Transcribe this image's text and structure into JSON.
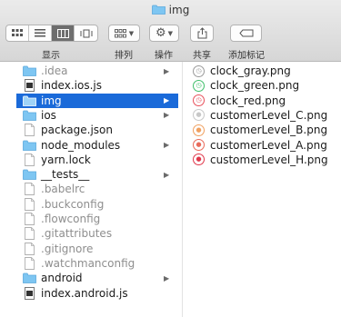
{
  "window": {
    "title": "img"
  },
  "toolbar": {
    "view_label": "显示",
    "arrange_label": "排列",
    "action_label": "操作",
    "share_label": "共享",
    "tag_label": "添加标记"
  },
  "column1": {
    "items": [
      {
        "name": ".idea",
        "kind": "folder",
        "dim": true,
        "arrow": true
      },
      {
        "name": "index.ios.js",
        "kind": "file",
        "dim": false,
        "arrow": false
      },
      {
        "name": "img",
        "kind": "folder",
        "dim": false,
        "arrow": true,
        "selected": true
      },
      {
        "name": "ios",
        "kind": "folder",
        "dim": false,
        "arrow": true
      },
      {
        "name": "package.json",
        "kind": "doc",
        "dim": false,
        "arrow": false
      },
      {
        "name": "node_modules",
        "kind": "folder",
        "dim": false,
        "arrow": true
      },
      {
        "name": "yarn.lock",
        "kind": "doc",
        "dim": false,
        "arrow": false
      },
      {
        "name": "__tests__",
        "kind": "folder",
        "dim": false,
        "arrow": true
      },
      {
        "name": ".babelrc",
        "kind": "doc",
        "dim": true,
        "arrow": false
      },
      {
        "name": ".buckconfig",
        "kind": "doc",
        "dim": true,
        "arrow": false
      },
      {
        "name": ".flowconfig",
        "kind": "doc",
        "dim": true,
        "arrow": false
      },
      {
        "name": ".gitattributes",
        "kind": "doc",
        "dim": true,
        "arrow": false
      },
      {
        "name": ".gitignore",
        "kind": "doc",
        "dim": true,
        "arrow": false
      },
      {
        "name": ".watchmanconfig",
        "kind": "doc",
        "dim": true,
        "arrow": false
      },
      {
        "name": "android",
        "kind": "folder",
        "dim": false,
        "arrow": true
      },
      {
        "name": "index.android.js",
        "kind": "file",
        "dim": false,
        "arrow": false
      }
    ]
  },
  "column2": {
    "items": [
      {
        "name": "clock_gray.png",
        "color": "#9a9a9a"
      },
      {
        "name": "clock_green.png",
        "color": "#3fbf6a"
      },
      {
        "name": "clock_red.png",
        "color": "#e8505b"
      },
      {
        "name": "customerLevel_C.png",
        "color": "#c8c8c8"
      },
      {
        "name": "customerLevel_B.png",
        "color": "#f0a060"
      },
      {
        "name": "customerLevel_A.png",
        "color": "#e86a5a"
      },
      {
        "name": "customerLevel_H.png",
        "color": "#e0374a"
      }
    ]
  }
}
